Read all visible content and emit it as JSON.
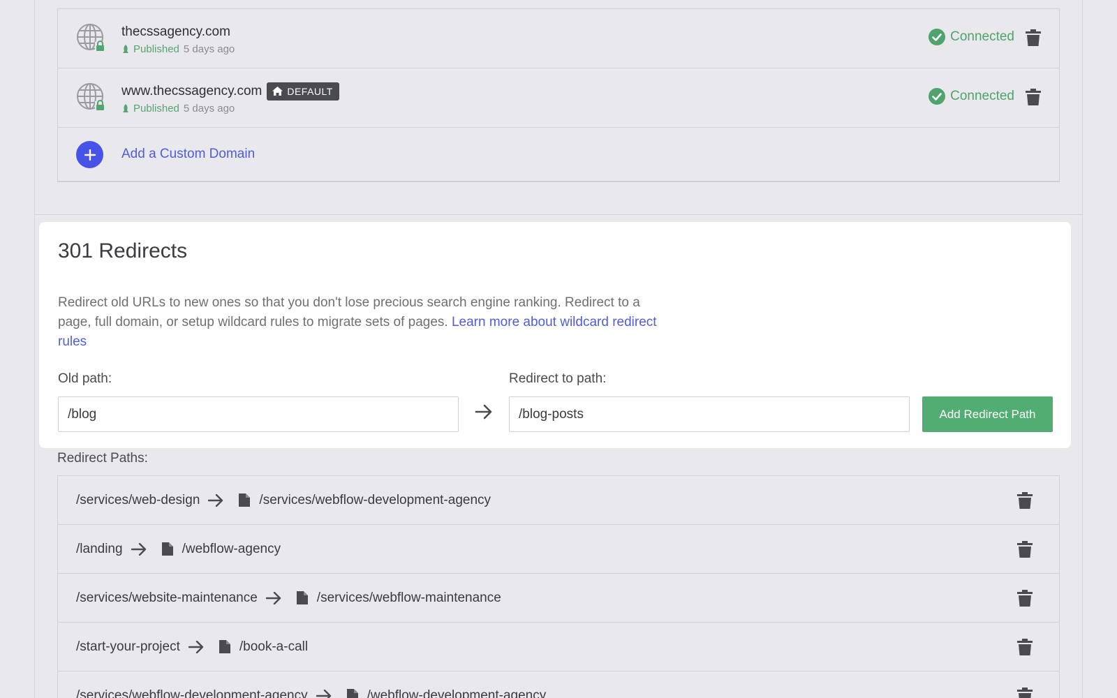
{
  "domains": [
    {
      "name": "thecssagency.com",
      "default_label": "",
      "published": "Published",
      "ago": "5 days ago",
      "status": "Connected"
    },
    {
      "name": "www.thecssagency.com",
      "default_label": "DEFAULT",
      "published": "Published",
      "ago": "5 days ago",
      "status": "Connected"
    }
  ],
  "add_domain": {
    "label": "Add a Custom Domain"
  },
  "redirects": {
    "title": "301 Redirects",
    "description": "Redirect old URLs to new ones so that you don't lose precious search engine ranking. Redirect to a page, full domain, or setup wildcard rules to migrate sets of pages.",
    "learn_more": "Learn more about wildcard redirect rules",
    "old_path_label": "Old path:",
    "old_path_value": "/blog",
    "new_path_label": "Redirect to path:",
    "new_path_value": "/blog-posts",
    "add_button": "Add Redirect Path",
    "paths_label": "Redirect Paths:",
    "paths": [
      {
        "from": "/services/web-design",
        "to": "/services/webflow-development-agency"
      },
      {
        "from": "/landing",
        "to": "/webflow-agency"
      },
      {
        "from": "/services/website-maintenance",
        "to": "/services/webflow-maintenance"
      },
      {
        "from": "/start-your-project",
        "to": "/book-a-call"
      },
      {
        "from": "/services/webflow-development-agency",
        "to": "/webflow-development-agency"
      }
    ]
  },
  "colors": {
    "accent": "#4753e6",
    "success": "#52ad73",
    "link": "#4f5ddc",
    "badge": "#4a4a51"
  },
  "icons": {
    "domain": "globe-lock-icon",
    "published": "rocket-icon",
    "status": "check-circle-icon",
    "delete": "trash-icon",
    "add": "plus-icon",
    "arrow": "arrow-right-icon",
    "page": "page-icon",
    "home": "home-icon"
  }
}
